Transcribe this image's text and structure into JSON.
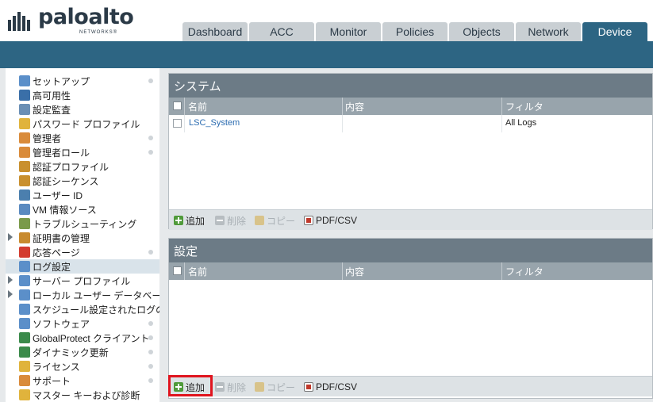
{
  "header": {
    "logo_text": "paloalto",
    "logo_sub": "NETWORKS®"
  },
  "tabs": [
    {
      "label": "Dashboard",
      "active": false
    },
    {
      "label": "ACC",
      "active": false
    },
    {
      "label": "Monitor",
      "active": false
    },
    {
      "label": "Policies",
      "active": false
    },
    {
      "label": "Objects",
      "active": false
    },
    {
      "label": "Network",
      "active": false
    },
    {
      "label": "Device",
      "active": true
    }
  ],
  "sidebar": {
    "items": [
      {
        "label": "セットアップ",
        "icon": "setup-icon",
        "color": "#5b8fc9",
        "dot": true,
        "expandable": false,
        "selected": false
      },
      {
        "label": "高可用性",
        "icon": "high-availability-icon",
        "color": "#3a6fa8",
        "dot": false,
        "expandable": false,
        "selected": false
      },
      {
        "label": "設定監査",
        "icon": "config-audit-icon",
        "color": "#6a8fb5",
        "dot": false,
        "expandable": false,
        "selected": false
      },
      {
        "label": "パスワード プロファイル",
        "icon": "password-profile-icon",
        "color": "#e0b33c",
        "dot": false,
        "expandable": false,
        "selected": false
      },
      {
        "label": "管理者",
        "icon": "administrator-icon",
        "color": "#d98b3a",
        "dot": true,
        "expandable": false,
        "selected": false
      },
      {
        "label": "管理者ロール",
        "icon": "admin-role-icon",
        "color": "#d98b3a",
        "dot": true,
        "expandable": false,
        "selected": false
      },
      {
        "label": "認証プロファイル",
        "icon": "auth-profile-icon",
        "color": "#c9902f",
        "dot": false,
        "expandable": false,
        "selected": false
      },
      {
        "label": "認証シーケンス",
        "icon": "auth-sequence-icon",
        "color": "#c9902f",
        "dot": false,
        "expandable": false,
        "selected": false
      },
      {
        "label": "ユーザー ID",
        "icon": "user-id-icon",
        "color": "#4b7fae",
        "dot": false,
        "expandable": false,
        "selected": false
      },
      {
        "label": "VM 情報ソース",
        "icon": "vm-info-source-icon",
        "color": "#5a8ac0",
        "dot": false,
        "expandable": false,
        "selected": false
      },
      {
        "label": "トラブルシューティング",
        "icon": "troubleshooting-icon",
        "color": "#7a9a4a",
        "dot": false,
        "expandable": false,
        "selected": false
      },
      {
        "label": "証明書の管理",
        "icon": "certificate-management-icon",
        "color": "#c88a2e",
        "dot": false,
        "expandable": true,
        "selected": false
      },
      {
        "label": "応答ページ",
        "icon": "response-pages-icon",
        "color": "#d33b2f",
        "dot": true,
        "expandable": false,
        "selected": false
      },
      {
        "label": "ログ設定",
        "icon": "log-settings-icon",
        "color": "#5b8fc9",
        "dot": false,
        "expandable": false,
        "selected": true
      },
      {
        "label": "サーバー プロファイル",
        "icon": "server-profile-icon",
        "color": "#5b8fc9",
        "dot": false,
        "expandable": true,
        "selected": false
      },
      {
        "label": "ローカル ユーザー データベース",
        "icon": "local-user-db-icon",
        "color": "#5b8fc9",
        "dot": false,
        "expandable": true,
        "selected": false
      },
      {
        "label": "スケジュール設定されたログのエクスポート",
        "icon": "scheduled-log-export-icon",
        "color": "#5b8fc9",
        "dot": false,
        "expandable": false,
        "selected": false
      },
      {
        "label": "ソフトウェア",
        "icon": "software-icon",
        "color": "#5b8fc9",
        "dot": true,
        "expandable": false,
        "selected": false
      },
      {
        "label": "GlobalProtect クライアント",
        "icon": "globalprotect-icon",
        "color": "#3a8a4a",
        "dot": true,
        "expandable": false,
        "selected": false
      },
      {
        "label": "ダイナミック更新",
        "icon": "dynamic-updates-icon",
        "color": "#3a8a4a",
        "dot": true,
        "expandable": false,
        "selected": false
      },
      {
        "label": "ライセンス",
        "icon": "license-icon",
        "color": "#e0b33c",
        "dot": true,
        "expandable": false,
        "selected": false
      },
      {
        "label": "サポート",
        "icon": "support-icon",
        "color": "#d98b3a",
        "dot": true,
        "expandable": false,
        "selected": false
      },
      {
        "label": "マスター キーおよび診断",
        "icon": "master-key-icon",
        "color": "#e0b33c",
        "dot": false,
        "expandable": false,
        "selected": false
      }
    ]
  },
  "panels": {
    "system": {
      "title": "システム",
      "columns": [
        "名前",
        "内容",
        "フィルタ"
      ],
      "rows": [
        {
          "name": "LSC_System",
          "description": "",
          "filter": "All Logs"
        }
      ]
    },
    "config": {
      "title": "設定",
      "columns": [
        "名前",
        "内容",
        "フィルタ"
      ],
      "rows": []
    }
  },
  "toolbar": {
    "add": "追加",
    "delete": "削除",
    "copy": "コピー",
    "pdfcsv": "PDF/CSV"
  },
  "colors": {
    "brand_blue": "#2d6583",
    "panel_title": "#6c7b86",
    "highlight": "#e0141e"
  }
}
